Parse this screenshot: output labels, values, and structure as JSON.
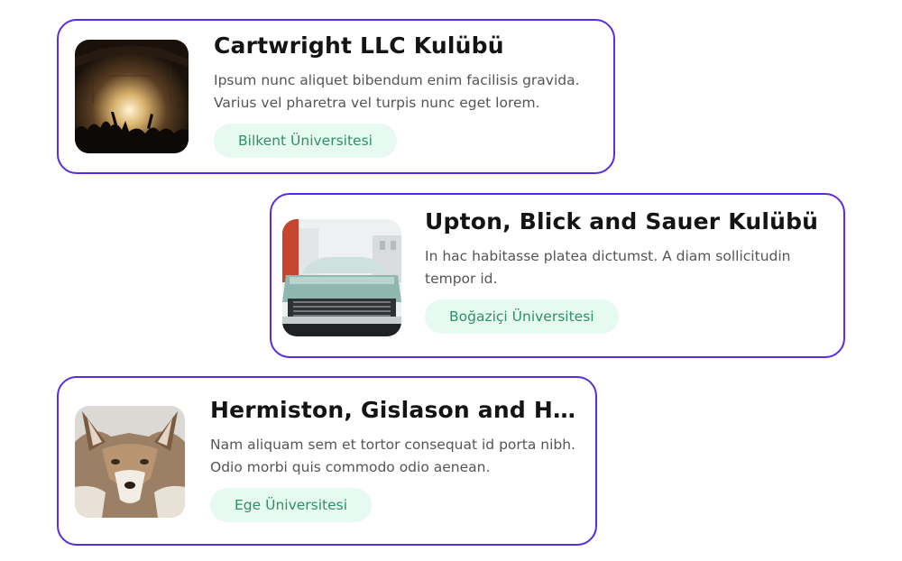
{
  "cards": [
    {
      "title": "Cartwright LLC Kulübü",
      "description": "Ipsum nunc aliquet bibendum enim facilisis gravida. Varius vel pharetra vel turpis nunc eget lorem.",
      "university": "Bilkent Üniversitesi",
      "image": "concert-photo"
    },
    {
      "title": "Upton, Blick and Sauer Kulübü",
      "description": "In hac habitasse platea dictumst. A diam sollicitudin tempor id.",
      "university": "Boğaziçi Üniversitesi",
      "image": "vintage-car-photo"
    },
    {
      "title": "Hermiston, Gislason and Hartmann Kulübü",
      "description": "Nam aliquam sem et tortor consequat id porta nibh. Odio morbi quis commodo odio aenean.",
      "university": "Ege Üniversitesi",
      "image": "coyote-photo"
    }
  ],
  "colors": {
    "card_border": "#5b2be0",
    "badge_bg": "#e6faf1",
    "badge_text": "#2f8f6a",
    "title_text": "#141414",
    "body_text": "#555555"
  }
}
